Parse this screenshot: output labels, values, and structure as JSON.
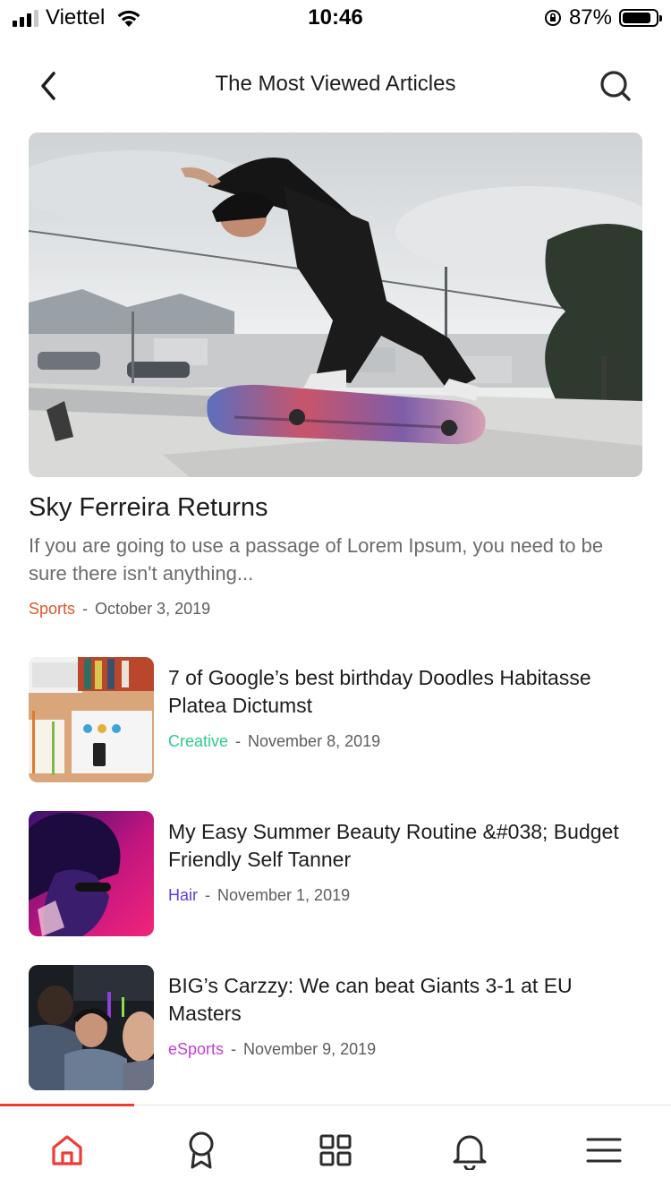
{
  "status_bar": {
    "carrier": "Viettel",
    "time": "10:46",
    "battery_percent": "87%",
    "battery_level": 0.87
  },
  "header": {
    "title": "The Most Viewed Articles",
    "back_icon": "chevron-left-icon",
    "search_icon": "search-icon"
  },
  "featured": {
    "title": "Sky Ferreira Returns",
    "excerpt": "If you are going to use a passage of Lorem Ipsum, you need to be sure there isn't anything...",
    "category": "Sports",
    "category_color": "#e0552b",
    "separator": "-",
    "date": "October 3, 2019"
  },
  "articles": [
    {
      "title": "7 of Google’s best birthday Doodles Habitasse Platea Dictumst",
      "category": "Creative",
      "category_color": "#2ecc8a",
      "separator": "-",
      "date": "November 8, 2019"
    },
    {
      "title": "My Easy Summer Beauty Routine &#038; Budget Friendly Self Tanner",
      "category": "Hair",
      "category_color": "#5b3fd9",
      "separator": "-",
      "date": "November 1, 2019"
    },
    {
      "title": "BIG’s Carzzy: We can beat Giants 3-1 at EU Masters",
      "category": "eSports",
      "category_color": "#c23fd9",
      "separator": "-",
      "date": "November 9, 2019"
    }
  ],
  "tab_bar": {
    "active_color": "#ef3b36",
    "active_index": 0,
    "tabs": [
      {
        "icon": "home-icon"
      },
      {
        "icon": "award-icon"
      },
      {
        "icon": "grid-icon"
      },
      {
        "icon": "bell-icon"
      },
      {
        "icon": "menu-icon"
      }
    ]
  }
}
